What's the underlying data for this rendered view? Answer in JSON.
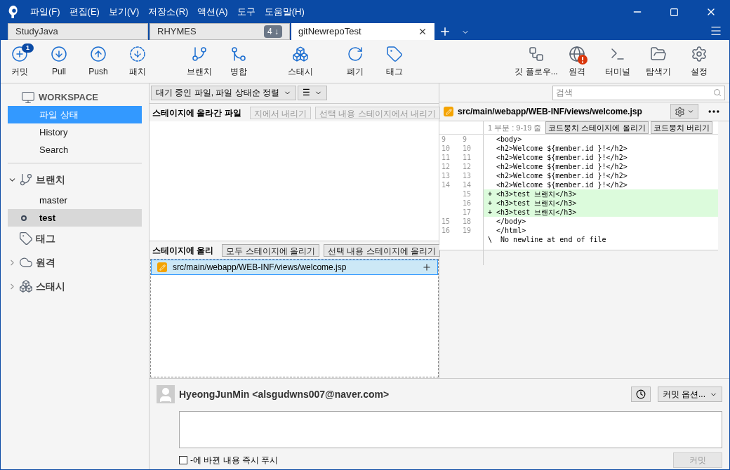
{
  "menu": [
    "파일(F)",
    "편집(E)",
    "보기(V)",
    "저장소(R)",
    "액션(A)",
    "도구",
    "도움말(H)"
  ],
  "tabs": [
    {
      "label": "StudyJava",
      "selected": false
    },
    {
      "label": "RHYMES",
      "selected": false,
      "badge": "4 ↓"
    },
    {
      "label": "gitNewrepoTest",
      "selected": true
    }
  ],
  "toolbar": {
    "left": [
      {
        "label": "커밋",
        "badge": "1"
      },
      {
        "label": "Pull"
      },
      {
        "label": "Push"
      },
      {
        "label": "패치"
      },
      {
        "label": "브랜치"
      },
      {
        "label": "병합"
      },
      {
        "label": "스태시"
      },
      {
        "label": "폐기"
      },
      {
        "label": "태그"
      }
    ],
    "right": [
      {
        "label": "깃 플로우..."
      },
      {
        "label": "원격",
        "alert": true
      },
      {
        "label": "터미널"
      },
      {
        "label": "탐색기"
      },
      {
        "label": "설정"
      }
    ]
  },
  "sidebar": {
    "workspace": "WORKSPACE",
    "workspace_items": [
      {
        "label": "파일 상태",
        "selected": true
      },
      {
        "label": "History",
        "selected": false
      },
      {
        "label": "Search",
        "selected": false
      }
    ],
    "sections": [
      {
        "label": "브랜치",
        "expanded": true,
        "items": [
          {
            "label": "master",
            "selected": false,
            "current": false
          },
          {
            "label": "test",
            "selected": true,
            "current": true
          }
        ]
      },
      {
        "label": "태그"
      },
      {
        "label": "원격",
        "expanded": false
      },
      {
        "label": "스태시",
        "expanded": false
      }
    ]
  },
  "filter": {
    "label": "대기 중인 파일, 파일 상태순 정렬",
    "view_icon": "☰"
  },
  "search": {
    "placeholder": "검색"
  },
  "staged": {
    "title": "스테이지에 올라간 파일",
    "buttons": [
      {
        "label": "지에서 내리기",
        "disabled": true
      },
      {
        "label": "선택 내용 스테이지에서 내리기",
        "disabled": true
      }
    ]
  },
  "unstaged": {
    "title": "스테이지에 올리",
    "buttons": [
      {
        "label": "모두 스테이지에 올리기",
        "disabled": false
      },
      {
        "label": "선택 내용 스테이지에 올리기",
        "disabled": false
      }
    ],
    "files": [
      {
        "path": "src/main/webapp/WEB-INF/views/welcome.jsp",
        "selected": true
      }
    ]
  },
  "diff": {
    "path": "src/main/webapp/WEB-INF/views/welcome.jsp",
    "hunk": "1 부분 : 9-19 줄",
    "buttons": [
      "코드뭉치 스테이지에 올리기",
      "코드뭉치 버리기"
    ],
    "lines": [
      {
        "kind": "context",
        "old": "9",
        "new": "9",
        "text": "  <body>"
      },
      {
        "kind": "context",
        "old": "10",
        "new": "10",
        "text": "  <h2>Welcome ${member.id }!</h2>"
      },
      {
        "kind": "context",
        "old": "11",
        "new": "11",
        "text": "  <h2>Welcome ${member.id }!</h2>"
      },
      {
        "kind": "context",
        "old": "12",
        "new": "12",
        "text": "  <h2>Welcome ${member.id }!</h2>"
      },
      {
        "kind": "context",
        "old": "13",
        "new": "13",
        "text": "  <h2>Welcome ${member.id }!</h2>"
      },
      {
        "kind": "context",
        "old": "14",
        "new": "14",
        "text": "  <h2>Welcome ${member.id }!</h2>"
      },
      {
        "kind": "added",
        "new": "15",
        "text": "+ <h3>test 브랜치</h3>"
      },
      {
        "kind": "added",
        "new": "16",
        "text": "+ <h3>test 브랜치</h3>"
      },
      {
        "kind": "added",
        "new": "17",
        "text": "+ <h3>test 브랜치</h3>"
      },
      {
        "kind": "context",
        "old": "15",
        "new": "18",
        "text": "  </body>"
      },
      {
        "kind": "context",
        "old": "16",
        "new": "19",
        "text": "  </html>"
      },
      {
        "kind": "note",
        "text": "\\  No newline at end of file"
      }
    ]
  },
  "commit": {
    "author": "HyeongJunMin <alsgudwns007@naver.com>",
    "options": "커밋 옵션...",
    "push_label": "-에 바뀐 내용 즉시 푸시",
    "push_checked": false,
    "button": "커밋",
    "button_disabled": true
  }
}
